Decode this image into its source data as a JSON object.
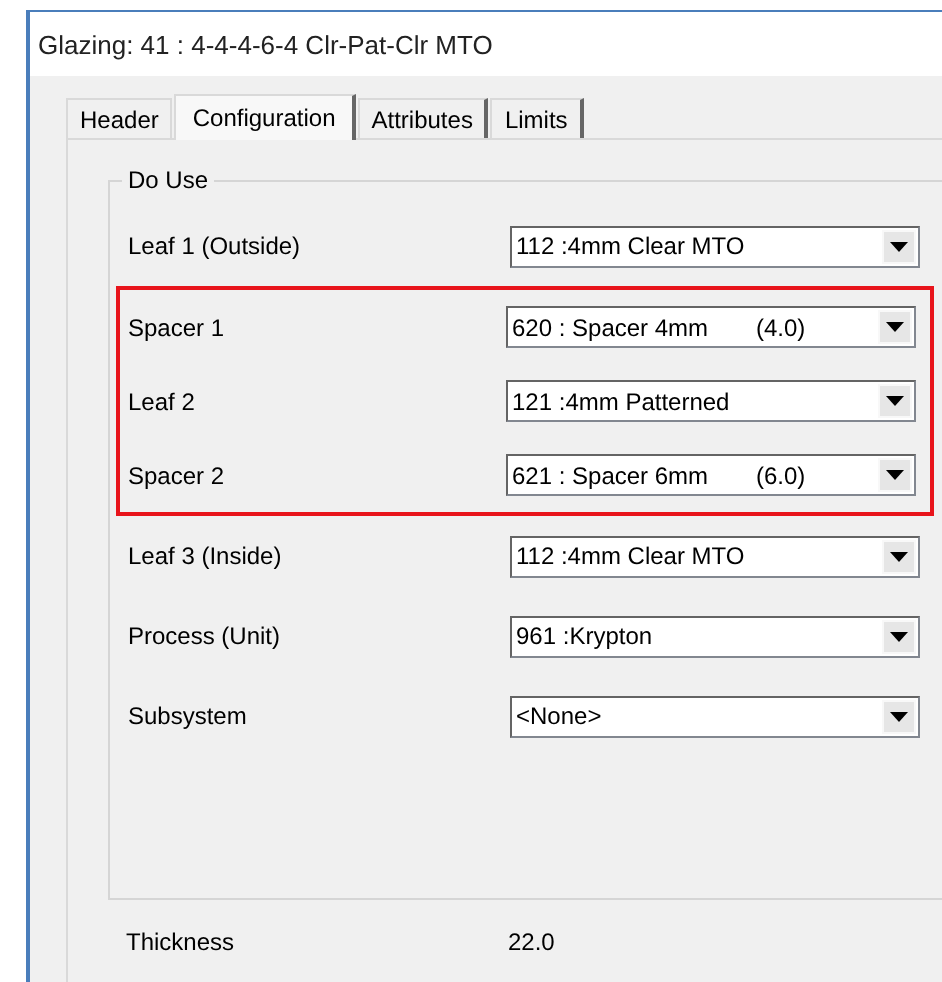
{
  "window": {
    "title": "Glazing: 41  :  4-4-4-6-4 Clr-Pat-Clr MTO"
  },
  "tabs": [
    {
      "label": "Header",
      "selected": false
    },
    {
      "label": "Configuration",
      "selected": true
    },
    {
      "label": "Attributes",
      "selected": false
    },
    {
      "label": "Limits",
      "selected": false
    }
  ],
  "group": {
    "title": "Do Use",
    "fields": [
      {
        "label": "Leaf 1 (Outside)",
        "value": "112 :4mm Clear MTO",
        "highlighted": false
      },
      {
        "label": "Spacer 1",
        "value": "620 : Spacer 4mm",
        "detail": "(4.0)",
        "highlighted": true
      },
      {
        "label": "Leaf 2",
        "value": "121 :4mm Patterned",
        "highlighted": true
      },
      {
        "label": "Spacer 2",
        "value": "621 : Spacer 6mm",
        "detail": "(6.0)",
        "highlighted": true
      },
      {
        "label": "Leaf 3 (Inside)",
        "value": "112 :4mm Clear MTO",
        "highlighted": false
      },
      {
        "label": "Process (Unit)",
        "value": "961 :Krypton",
        "highlighted": false
      },
      {
        "label": "Subsystem",
        "value": "<None>",
        "highlighted": false
      }
    ]
  },
  "thickness": {
    "label": "Thickness",
    "value": "22.0"
  }
}
